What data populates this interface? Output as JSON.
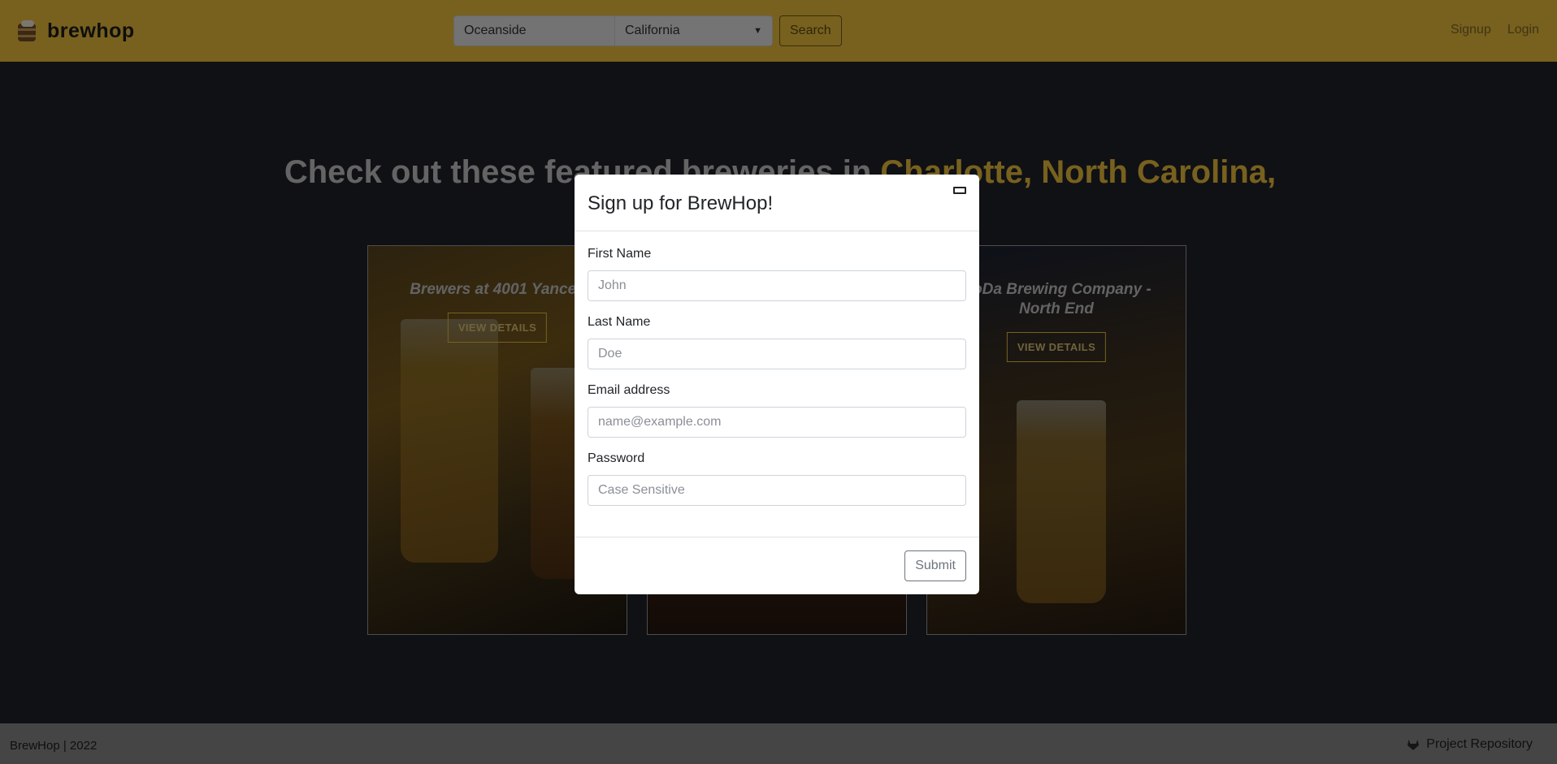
{
  "navbar": {
    "brand": "brewhop",
    "search": {
      "city_value": "Oceanside",
      "state_value": "California",
      "button_label": "Search"
    },
    "links": {
      "signup": "Signup",
      "login": "Login"
    }
  },
  "hero": {
    "headline_prefix": "Check out these featured breweries in ",
    "headline_location": "Charlotte, North Carolina,"
  },
  "cards": [
    {
      "title": "Brewers at 4001 Yancey",
      "button": "VIEW DETAILS"
    },
    {
      "title": "",
      "button": ""
    },
    {
      "title": "NoDa Brewing Company - North End",
      "button": "VIEW DETAILS"
    }
  ],
  "modal": {
    "title": "Sign up for BrewHop!",
    "fields": {
      "first_name": {
        "label": "First Name",
        "placeholder": "John"
      },
      "last_name": {
        "label": "Last Name",
        "placeholder": "Doe"
      },
      "email": {
        "label": "Email address",
        "placeholder": "name@example.com"
      },
      "password": {
        "label": "Password",
        "placeholder": "Case Sensitive"
      }
    },
    "submit_label": "Submit"
  },
  "footer": {
    "copyright": "BrewHop | 2022",
    "repo_link": "Project Repository"
  },
  "colors": {
    "navbar_bg": "#f0c23c",
    "page_bg": "#20222a",
    "accent": "#f0c23c",
    "footer_bg": "#8a8a8a"
  },
  "icons": {
    "brand": "beer-keg-icon",
    "close": "close-icon",
    "state_select": "chevron-down-icon",
    "repo": "gitlab-icon"
  }
}
